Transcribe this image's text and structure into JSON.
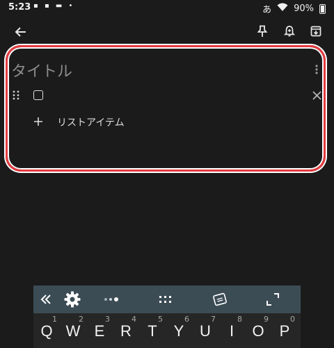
{
  "status_bar": {
    "time": "5:23",
    "notification_icons": "▪ ▪ ▬ •",
    "input_indicator": "あ",
    "battery": "90%"
  },
  "toolbar": {
    "icons": [
      "back-arrow-icon",
      "pin-icon",
      "reminder-icon",
      "archive-icon"
    ]
  },
  "note": {
    "title_placeholder": "タイトル",
    "add_item_label": "リストアイテム"
  },
  "keyboard": {
    "keys": [
      {
        "label": "Q",
        "num": "1"
      },
      {
        "label": "W",
        "num": "2"
      },
      {
        "label": "E",
        "num": "3"
      },
      {
        "label": "R",
        "num": "4"
      },
      {
        "label": "T",
        "num": "5"
      },
      {
        "label": "Y",
        "num": "6"
      },
      {
        "label": "U",
        "num": "7"
      },
      {
        "label": "I",
        "num": "8"
      },
      {
        "label": "O",
        "num": "9"
      },
      {
        "label": "P",
        "num": "0"
      }
    ]
  },
  "colors": {
    "background": "#1b1b1b",
    "highlight_border": "#e43a3f",
    "keyboard_toolbar": "#3c4c55"
  }
}
